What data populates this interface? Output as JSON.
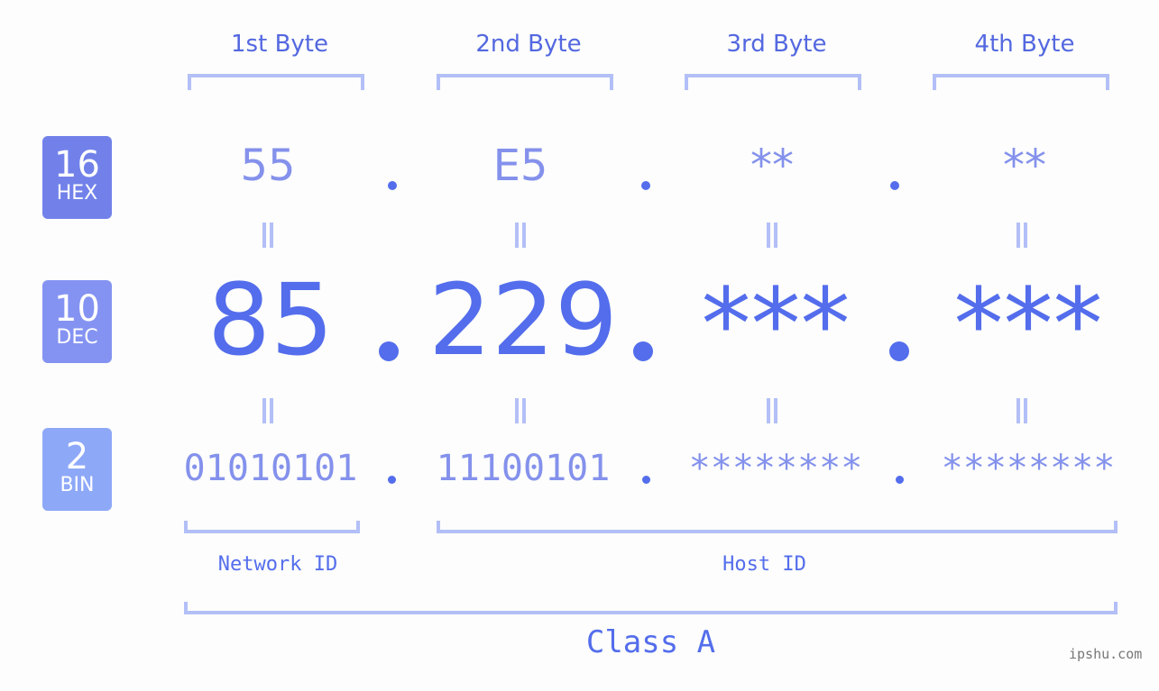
{
  "byte_headers": [
    "1st Byte",
    "2nd Byte",
    "3rd Byte",
    "4th Byte"
  ],
  "badges": [
    {
      "num": "16",
      "label": "HEX",
      "color": "#7281ea"
    },
    {
      "num": "10",
      "label": "DEC",
      "color": "#8493f2"
    },
    {
      "num": "2",
      "label": "BIN",
      "color": "#8ea8f8"
    }
  ],
  "hex": [
    "55",
    "E5",
    "**",
    "**"
  ],
  "dec": [
    "85",
    "229",
    "***",
    "***"
  ],
  "bin": [
    "01010101",
    "11100101",
    "********",
    "********"
  ],
  "network_id_label": "Network ID",
  "host_id_label": "Host ID",
  "class_label": "Class A",
  "watermark": "ipshu.com",
  "colors": {
    "accent": "#546dec",
    "light": "#8491ec",
    "bracket": "#b3bff7"
  }
}
